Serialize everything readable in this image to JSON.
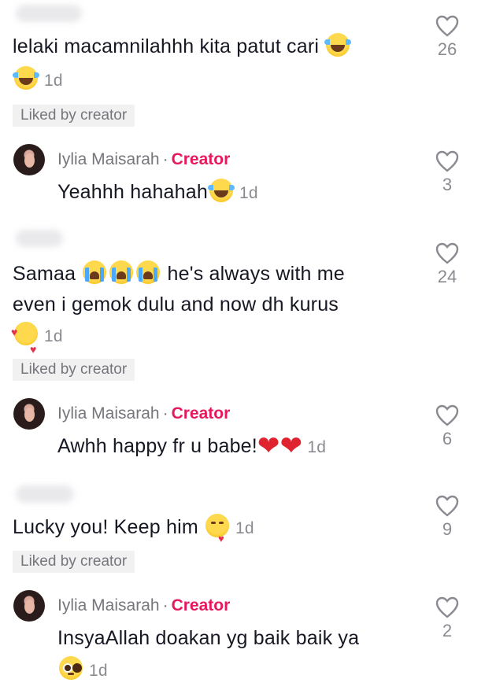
{
  "comments": [
    {
      "text": "lelaki macamnilahhh kita patut cari",
      "time": "1d",
      "badge": "Liked by creator",
      "likes": "26",
      "emoji": [
        "laughing-tears-emoji",
        "laughing-tears-emoji"
      ]
    },
    {
      "author": "Iylia Maisarah",
      "separator": "·",
      "tag": "Creator",
      "text": "Yeahhh hahahah",
      "time": "1d",
      "likes": "3",
      "emoji": [
        "laughing-tears-emoji"
      ]
    },
    {
      "text_part1": "Samaa",
      "text_part2": "he's always with me",
      "text_line2": "even i gemok dulu and now dh kurus",
      "time": "1d",
      "badge": "Liked by creator",
      "likes": "24",
      "emoji": [
        "loudly-crying-emoji",
        "loudly-crying-emoji",
        "loudly-crying-emoji",
        "smiling-hearts-emoji"
      ]
    },
    {
      "author": "Iylia Maisarah",
      "separator": "·",
      "tag": "Creator",
      "text": "Awhh happy fr u babe!",
      "time": "1d",
      "likes": "6",
      "emoji": [
        "red-heart-emoji",
        "red-heart-emoji"
      ]
    },
    {
      "text": "Lucky you! Keep him",
      "time": "1d",
      "badge": "Liked by creator",
      "likes": "9",
      "emoji": [
        "kissing-heart-emoji"
      ]
    },
    {
      "author": "Iylia Maisarah",
      "separator": "·",
      "tag": "Creator",
      "text": "InsyaAllah doakan yg baik baik ya",
      "time": "1d",
      "likes": "2",
      "emoji": [
        "pleading-face-emoji"
      ]
    }
  ],
  "colors": {
    "creator_tag": "#e6195d",
    "muted": "#8a8b91",
    "badge_bg": "#f1f1f2",
    "heart_red": "#e0242f"
  }
}
